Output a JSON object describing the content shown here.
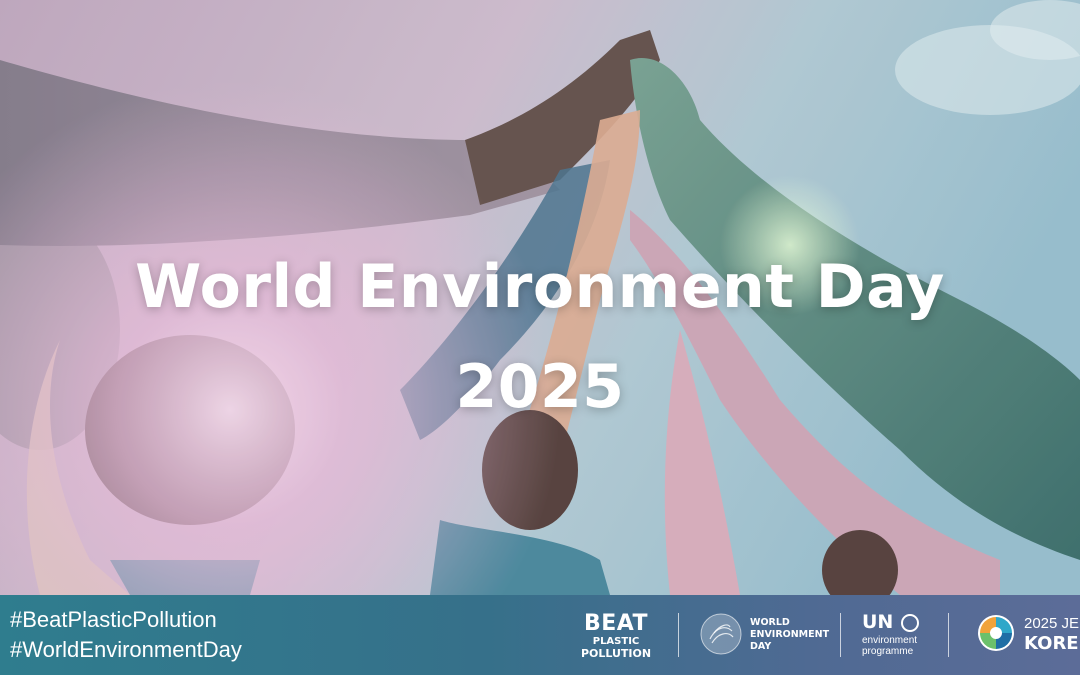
{
  "title": {
    "line1": "World Environment Day",
    "line2": "2025"
  },
  "hashtags": [
    "#BeatPlasticPollution",
    "#WorldEnvironmentDay"
  ],
  "logos": {
    "beat": {
      "line1": "BEAT",
      "line2": "PLASTIC",
      "line3": "POLLUTION"
    },
    "wed": {
      "line1": "WORLD",
      "line2": "ENVIRONMENT",
      "line3": "DAY"
    },
    "un": {
      "line1": "UN",
      "line2": "environment",
      "line3": "programme"
    },
    "jeju": {
      "line1": "2025 JE",
      "line2": "KORE"
    }
  },
  "colors": {
    "banner_start": "#2f7d8e",
    "banner_end": "#5c6c98",
    "sky": "#a9c9d3",
    "flare": "#e6b8d6",
    "text": "#ffffff"
  },
  "image": {
    "description_icon": "raised-hands-photo"
  }
}
